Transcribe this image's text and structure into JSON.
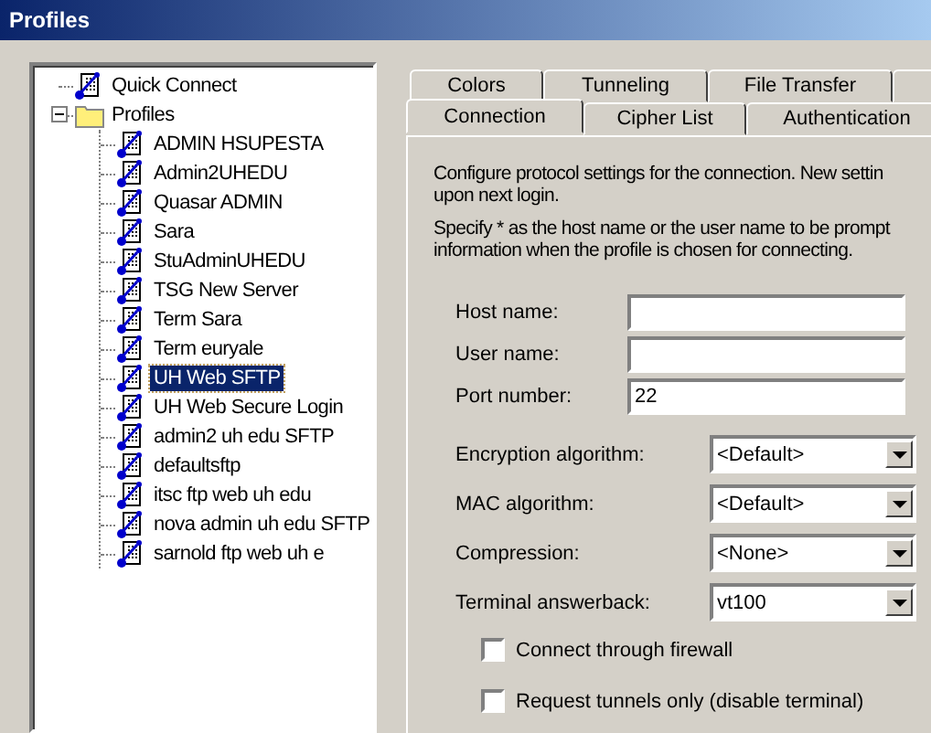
{
  "window": {
    "title": "Profiles"
  },
  "tree": [
    {
      "label": "Quick Connect",
      "kind": "profile",
      "selected": false
    },
    {
      "label": "Profiles",
      "kind": "folder",
      "expanded": true,
      "selected": false,
      "children": [
        {
          "label": "ADMIN HSUPESTA",
          "kind": "profile",
          "selected": false
        },
        {
          "label": "Admin2UHEDU",
          "kind": "profile",
          "selected": false
        },
        {
          "label": "Quasar ADMIN",
          "kind": "profile",
          "selected": false
        },
        {
          "label": "Sara",
          "kind": "profile",
          "selected": false
        },
        {
          "label": "StuAdminUHEDU",
          "kind": "profile",
          "selected": false
        },
        {
          "label": "TSG New Server",
          "kind": "profile",
          "selected": false
        },
        {
          "label": "Term Sara",
          "kind": "profile",
          "selected": false
        },
        {
          "label": "Term euryale",
          "kind": "profile",
          "selected": false
        },
        {
          "label": "UH Web SFTP",
          "kind": "profile",
          "selected": true
        },
        {
          "label": "UH Web Secure Login",
          "kind": "profile",
          "selected": false
        },
        {
          "label": "admin2 uh edu SFTP",
          "kind": "profile",
          "selected": false
        },
        {
          "label": "defaultsftp",
          "kind": "profile",
          "selected": false
        },
        {
          "label": "itsc ftp web uh edu",
          "kind": "profile",
          "selected": false
        },
        {
          "label": "nova admin uh edu SFTP",
          "kind": "profile",
          "selected": false
        },
        {
          "label": "sarnold ftp web uh e",
          "kind": "profile",
          "selected": false
        }
      ]
    }
  ],
  "tab_rows": [
    [
      {
        "label": "Colors",
        "selected": false
      },
      {
        "label": "Tunneling",
        "selected": false
      },
      {
        "label": "File Transfer",
        "selected": false
      },
      {
        "selected": false
      }
    ],
    [
      {
        "label": "Connection",
        "selected": true
      },
      {
        "label": "Cipher List",
        "selected": false
      },
      {
        "label": "Authentication",
        "selected": false
      }
    ]
  ],
  "description": [
    [
      "Configure protocol settings for the connection. New settin",
      "upon next login."
    ],
    [
      "Specify * as the host name or the user name to be prompt",
      "information when the profile is chosen for connecting."
    ]
  ],
  "fields": [
    {
      "kind": "text",
      "label": "Host name:"
    },
    {
      "kind": "text",
      "label": "User name:"
    },
    {
      "kind": "text",
      "label": "Port number:",
      "value": "22"
    },
    {
      "kind": "select",
      "label": "Encryption algorithm:",
      "value": "<Default>"
    },
    {
      "kind": "select",
      "label": "MAC algorithm:",
      "value": "<Default>"
    },
    {
      "kind": "select",
      "label": "Compression:",
      "value": "<None>"
    },
    {
      "kind": "select",
      "label": "Terminal answerback:",
      "value": "vt100"
    }
  ],
  "checkboxes": [
    {
      "label": "Connect through firewall",
      "checked": false
    },
    {
      "label": "Request tunnels only (disable terminal)",
      "checked": false
    }
  ]
}
